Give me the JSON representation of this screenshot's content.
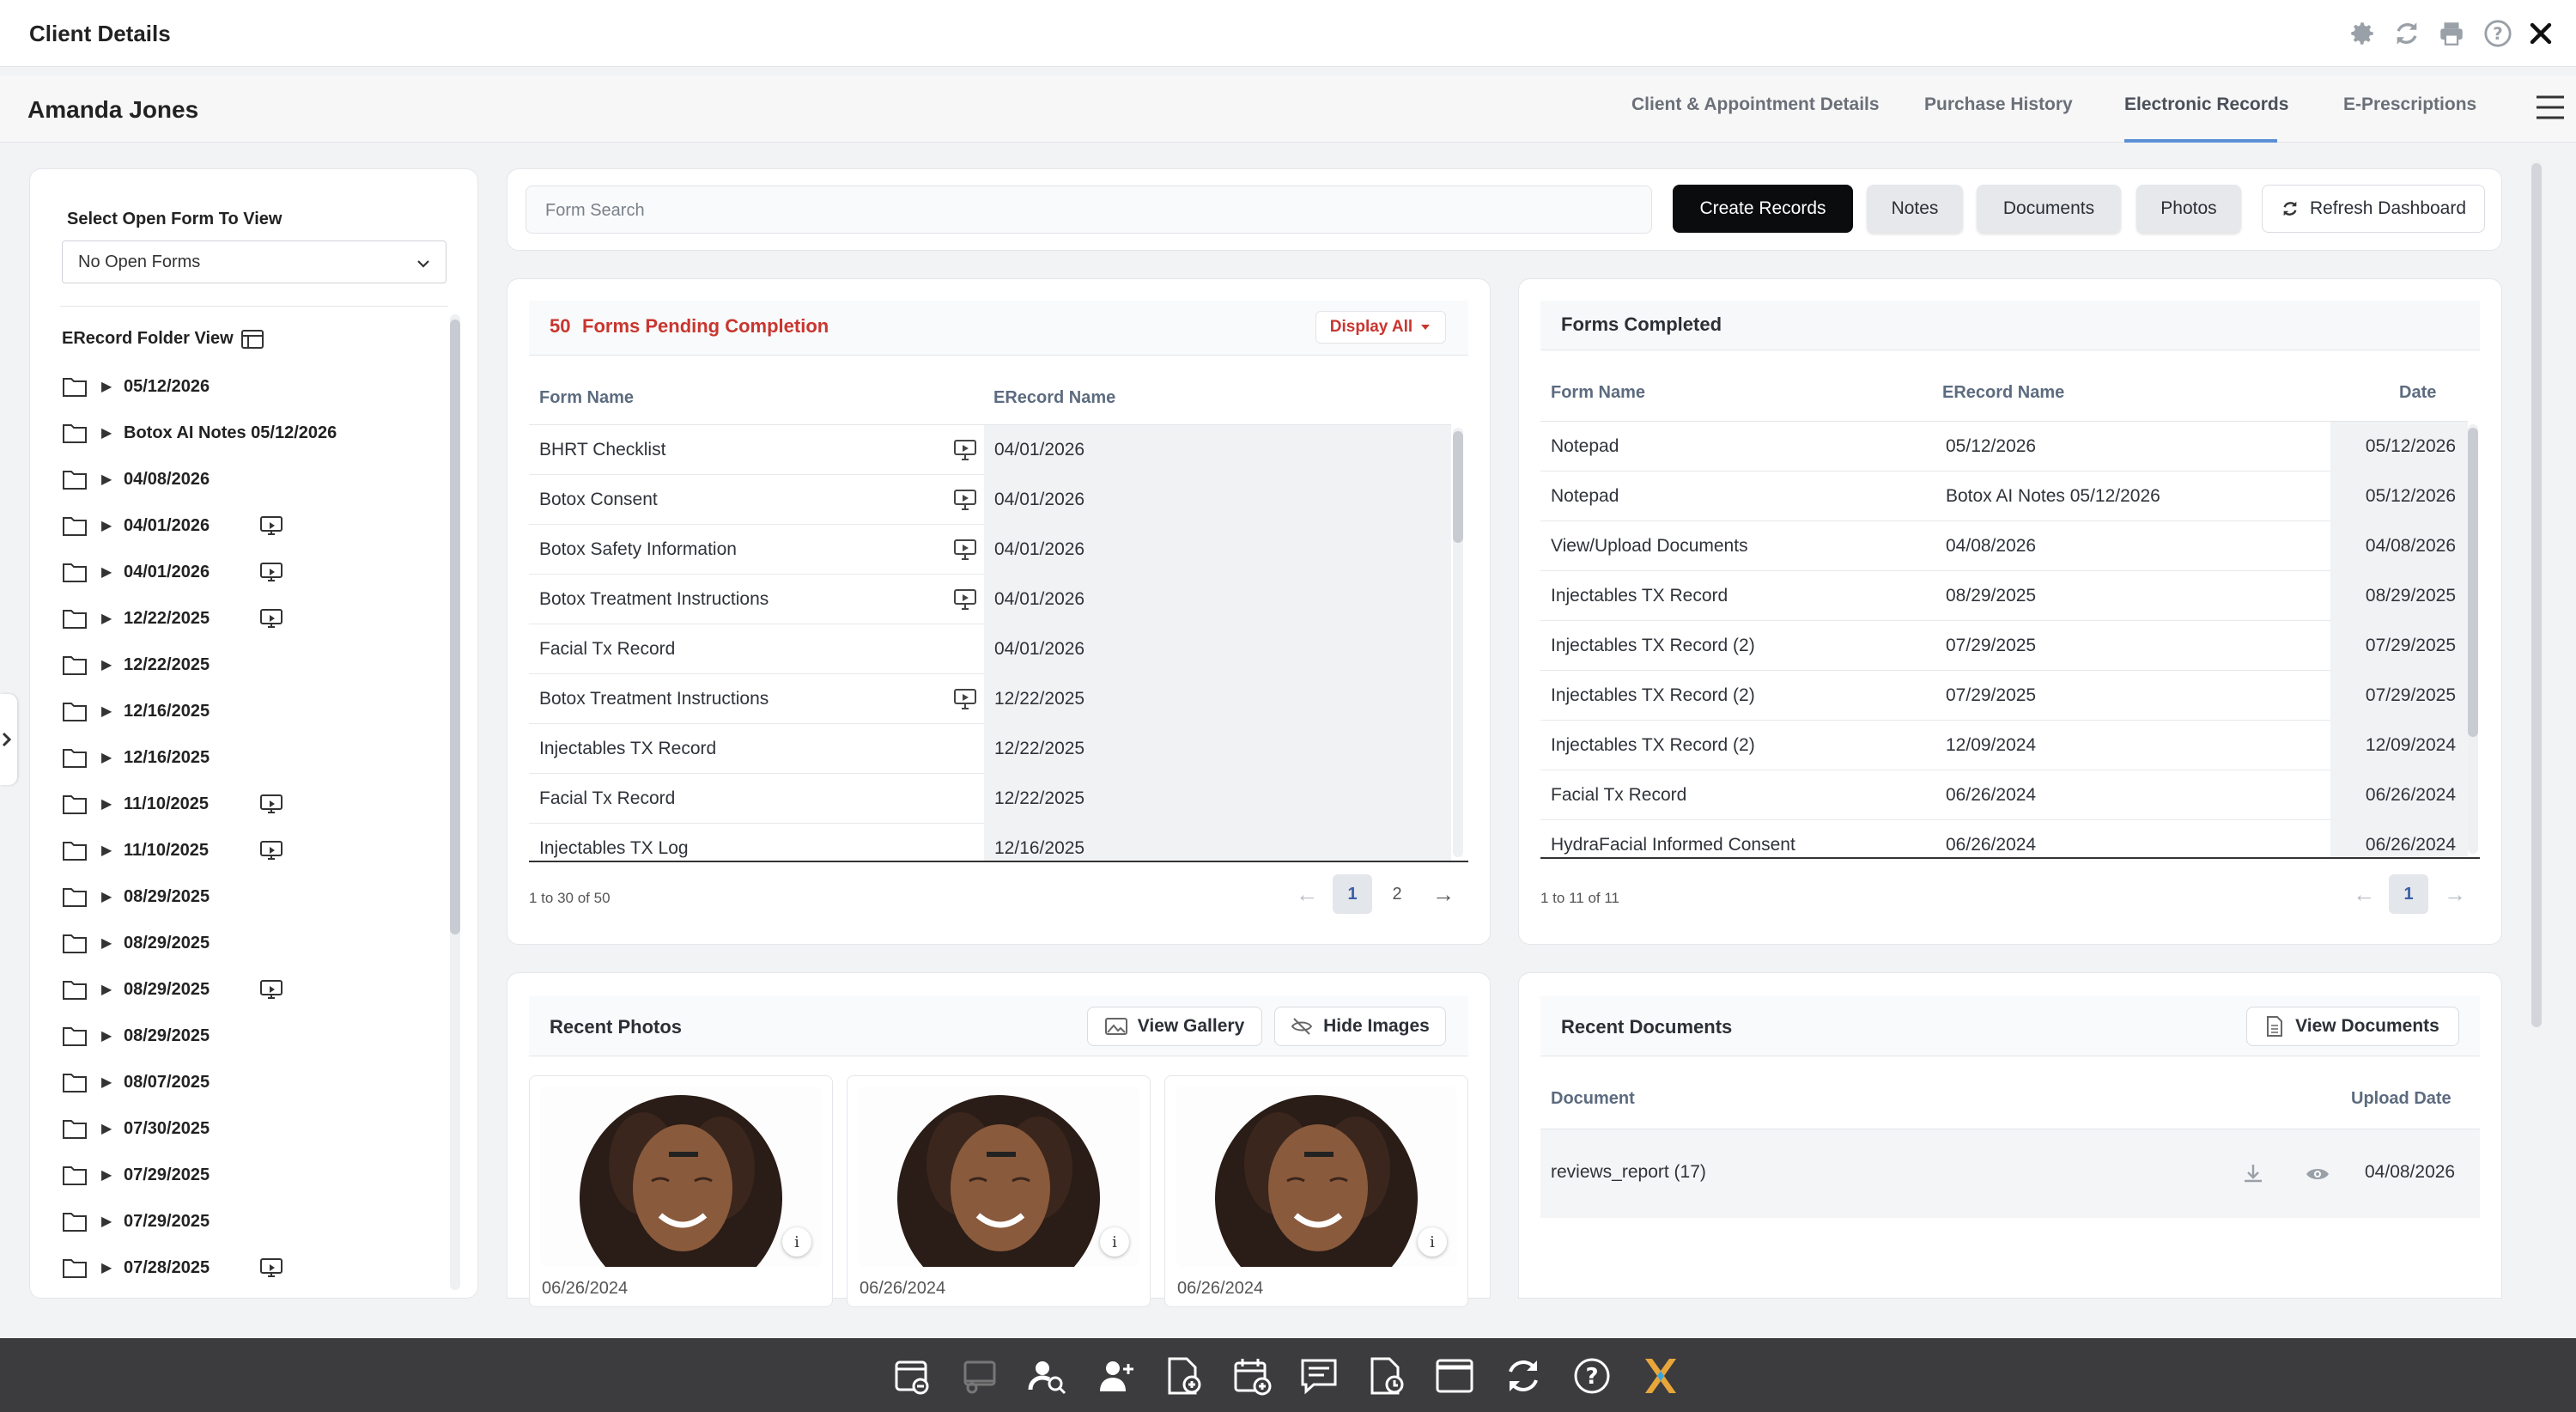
{
  "titlebar": {
    "title": "Client Details"
  },
  "header": {
    "client_name": "Amanda Jones",
    "tabs": [
      {
        "label": "Client & Appointment Details"
      },
      {
        "label": "Purchase History"
      },
      {
        "label": "Electronic Records",
        "active": true
      },
      {
        "label": "E-Prescriptions"
      }
    ]
  },
  "sidebar": {
    "select_label": "Select Open Form To View",
    "select_value": "No Open Forms",
    "folder_view_label": "ERecord Folder View",
    "folders": [
      {
        "label": "05/12/2026",
        "has_monitor": false
      },
      {
        "label": "Botox AI Notes 05/12/2026",
        "has_monitor": false
      },
      {
        "label": "04/08/2026",
        "has_monitor": false
      },
      {
        "label": "04/01/2026",
        "has_monitor": true
      },
      {
        "label": "04/01/2026",
        "has_monitor": true
      },
      {
        "label": "12/22/2025",
        "has_monitor": true
      },
      {
        "label": "12/22/2025",
        "has_monitor": false
      },
      {
        "label": "12/16/2025",
        "has_monitor": false
      },
      {
        "label": "12/16/2025",
        "has_monitor": false
      },
      {
        "label": "11/10/2025",
        "has_monitor": true
      },
      {
        "label": "11/10/2025",
        "has_monitor": true
      },
      {
        "label": "08/29/2025",
        "has_monitor": false
      },
      {
        "label": "08/29/2025",
        "has_monitor": false
      },
      {
        "label": "08/29/2025",
        "has_monitor": true
      },
      {
        "label": "08/29/2025",
        "has_monitor": false
      },
      {
        "label": "08/07/2025",
        "has_monitor": false
      },
      {
        "label": "07/30/2025",
        "has_monitor": false
      },
      {
        "label": "07/29/2025",
        "has_monitor": false
      },
      {
        "label": "07/29/2025",
        "has_monitor": false
      },
      {
        "label": "07/28/2025",
        "has_monitor": true
      }
    ]
  },
  "toolbar": {
    "search_placeholder": "Form Search",
    "create_records": "Create Records",
    "notes": "Notes",
    "documents": "Documents",
    "photos": "Photos",
    "refresh": "Refresh Dashboard"
  },
  "pending": {
    "count": "50",
    "title": "Forms Pending Completion",
    "display_all": "Display All",
    "col_form": "Form Name",
    "col_erecord": "ERecord Name",
    "rows": [
      {
        "form": "BHRT Checklist",
        "erecord": "04/01/2026",
        "monitor": true
      },
      {
        "form": "Botox Consent",
        "erecord": "04/01/2026",
        "monitor": true
      },
      {
        "form": "Botox Safety Information",
        "erecord": "04/01/2026",
        "monitor": true
      },
      {
        "form": "Botox Treatment Instructions",
        "erecord": "04/01/2026",
        "monitor": true
      },
      {
        "form": "Facial Tx Record",
        "erecord": "04/01/2026",
        "monitor": false
      },
      {
        "form": "Botox Treatment Instructions",
        "erecord": "12/22/2025",
        "monitor": true
      },
      {
        "form": "Injectables TX Record",
        "erecord": "12/22/2025",
        "monitor": false
      },
      {
        "form": "Facial Tx Record",
        "erecord": "12/22/2025",
        "monitor": false
      },
      {
        "form": "Injectables TX Log",
        "erecord": "12/16/2025",
        "monitor": false
      }
    ],
    "range": "1 to 30 of 50",
    "pages": [
      "1",
      "2"
    ]
  },
  "completed": {
    "title": "Forms Completed",
    "col_form": "Form Name",
    "col_erecord": "ERecord Name",
    "col_date": "Date",
    "rows": [
      {
        "form": "Notepad",
        "erecord": "05/12/2026",
        "date": "05/12/2026"
      },
      {
        "form": "Notepad",
        "erecord": "Botox AI Notes 05/12/2026",
        "date": "05/12/2026"
      },
      {
        "form": "View/Upload Documents",
        "erecord": "04/08/2026",
        "date": "04/08/2026"
      },
      {
        "form": "Injectables TX Record",
        "erecord": "08/29/2025",
        "date": "08/29/2025"
      },
      {
        "form": "Injectables TX Record (2)",
        "erecord": "07/29/2025",
        "date": "07/29/2025"
      },
      {
        "form": "Injectables TX Record (2)",
        "erecord": "07/29/2025",
        "date": "07/29/2025"
      },
      {
        "form": "Injectables TX Record (2)",
        "erecord": "12/09/2024",
        "date": "12/09/2024"
      },
      {
        "form": "Facial Tx Record",
        "erecord": "06/26/2024",
        "date": "06/26/2024"
      },
      {
        "form": "HydraFacial Informed Consent",
        "erecord": "06/26/2024",
        "date": "06/26/2024"
      }
    ],
    "range": "1 to 11 of 11",
    "pages": [
      "1"
    ]
  },
  "photos": {
    "title": "Recent Photos",
    "view_gallery": "View Gallery",
    "hide_images": "Hide Images",
    "items": [
      {
        "date": "06/26/2024"
      },
      {
        "date": "06/26/2024"
      },
      {
        "date": "06/26/2024"
      }
    ]
  },
  "documents": {
    "title": "Recent Documents",
    "view_documents": "View Documents",
    "col_document": "Document",
    "col_upload": "Upload Date",
    "rows": [
      {
        "name": "reviews_report (17)",
        "date": "04/08/2026"
      }
    ]
  },
  "colors": {
    "accent": "#5b8fd6",
    "pending_red": "#c8362f",
    "dark_button": "#0b0c0e"
  },
  "icons": {
    "titlebar": [
      "gear-icon",
      "refresh-icon",
      "print-icon",
      "help-icon",
      "close-icon"
    ],
    "taskbar": [
      "checkin-icon",
      "cast-icon",
      "client-search-icon",
      "add-client-icon",
      "invoice-icon",
      "add-appointment-icon",
      "messages-icon",
      "schedule-icon",
      "window-icon",
      "sync-icon",
      "help-icon",
      "app-logo-icon"
    ]
  }
}
